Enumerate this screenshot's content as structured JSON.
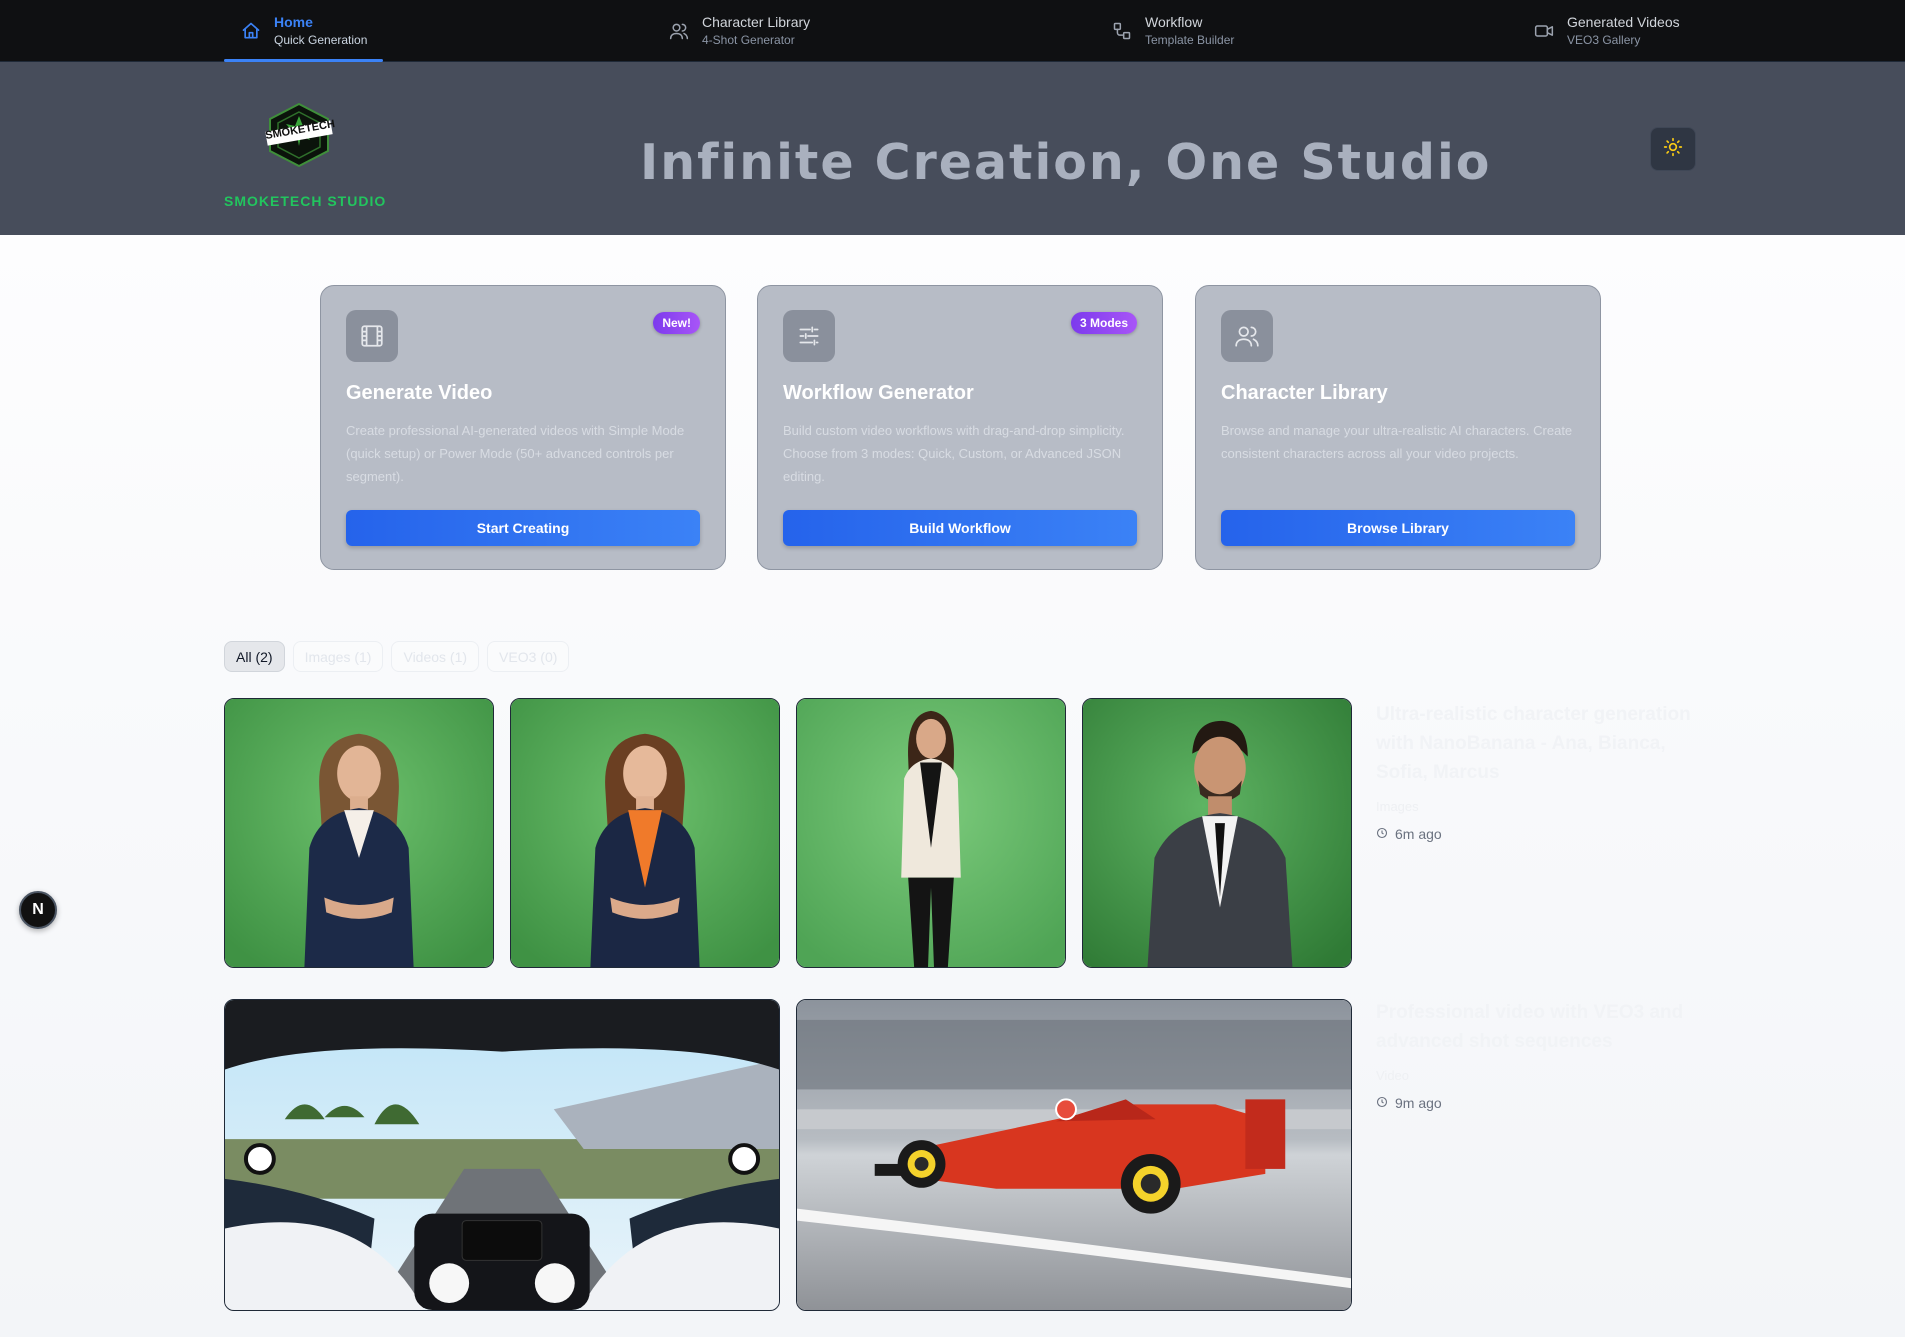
{
  "nav": {
    "items": [
      {
        "label": "Home",
        "sub": "Quick Generation",
        "icon": "home-icon"
      },
      {
        "label": "Character Library",
        "sub": "4-Shot Generator",
        "icon": "users-icon"
      },
      {
        "label": "Workflow",
        "sub": "Template Builder",
        "icon": "workflow-icon"
      },
      {
        "label": "Generated Videos",
        "sub": "VEO3 Gallery",
        "icon": "video-icon"
      }
    ],
    "active_color": "#3b82f6"
  },
  "hero": {
    "brand": "SMOKETECH STUDIO",
    "logo_text": "SMOKETECH",
    "title": "Infinite Creation, One Studio",
    "brand_color": "#22c55e",
    "theme_icon": "sun-icon"
  },
  "cards": [
    {
      "title": "Generate Video",
      "badge": "New!",
      "icon": "film-icon",
      "desc": "Create professional AI-generated videos with Simple Mode (quick setup) or Power Mode (50+ advanced controls per segment).",
      "button": "Start Creating"
    },
    {
      "title": "Workflow Generator",
      "badge": "3 Modes",
      "icon": "sliders-icon",
      "desc": "Build custom video workflows with drag-and-drop simplicity. Choose from 3 modes: Quick, Custom, or Advanced JSON editing.",
      "button": "Build Workflow"
    },
    {
      "title": "Character Library",
      "icon": "users-icon",
      "desc": "Browse and manage your ultra-realistic AI characters. Create consistent characters across all your video projects.",
      "button": "Browse Library"
    }
  ],
  "filters": [
    "All (2)",
    "Images (1)",
    "Videos (1)",
    "VEO3 (0)"
  ],
  "gallery": [
    {
      "title": "Ultra-realistic character generation with NanoBanana - Ana, Bianca, Sofia, Marcus",
      "type": "Images",
      "time": "6m ago"
    },
    {
      "title": "Professional video with VEO3 and advanced shot sequences",
      "type": "Video",
      "time": "9m ago"
    }
  ],
  "dev_badge": "N"
}
